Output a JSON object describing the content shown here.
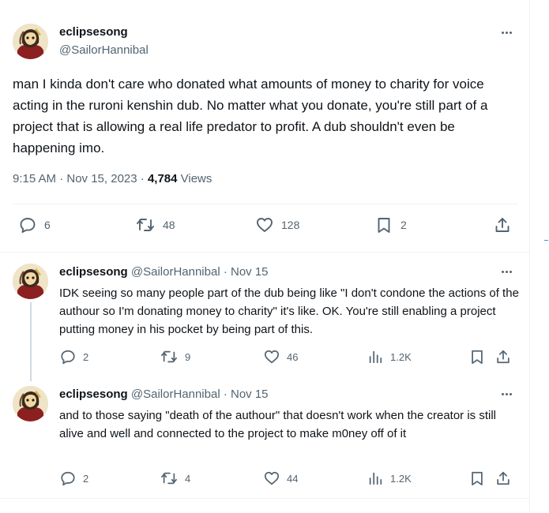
{
  "main_tweet": {
    "display_name": "eclipsesong",
    "handle": "@SailorHannibal",
    "text": "man I kinda don't care who donated what amounts of money to charity for voice acting in the ruroni kenshin dub. No matter what you donate, you're still part of a project that is allowing a real life predator to profit. A dub shouldn't even be happening imo.",
    "time": "9:15 AM · Nov 15, 2023 · ",
    "views_count": "4,784",
    "views_label": " Views",
    "replies": "6",
    "reposts": "48",
    "likes": "128",
    "bookmarks": "2"
  },
  "replies": [
    {
      "display_name": "eclipsesong",
      "handle": "@SailorHannibal",
      "date": " · Nov 15",
      "text": "IDK seeing so many people part of the dub being like \"I don't condone the actions of the authour so I'm donating money to charity\" it's like. OK. You're still enabling a project putting money in his pocket by being part of this.",
      "replies": "2",
      "reposts": "9",
      "likes": "46",
      "views": "1.2K"
    },
    {
      "display_name": "eclipsesong",
      "handle": "@SailorHannibal",
      "date": " · Nov 15",
      "text": "and to those saying \"death of the authour\" that doesn't work when the creator is still alive and well and connected to the project to make m0ney off of it",
      "replies": "2",
      "reposts": "4",
      "likes": "44",
      "views": "1.2K"
    }
  ],
  "icons": {
    "reply": "reply-icon",
    "repost": "repost-icon",
    "like": "like-icon",
    "bookmark": "bookmark-icon",
    "share": "share-icon",
    "views": "views-icon",
    "more": "more-icon"
  },
  "colors": {
    "text": "#0f1419",
    "secondary": "#536471",
    "divider": "#eff3f4",
    "thread_line": "#cfd9de",
    "accent": "#1d9bf0"
  }
}
